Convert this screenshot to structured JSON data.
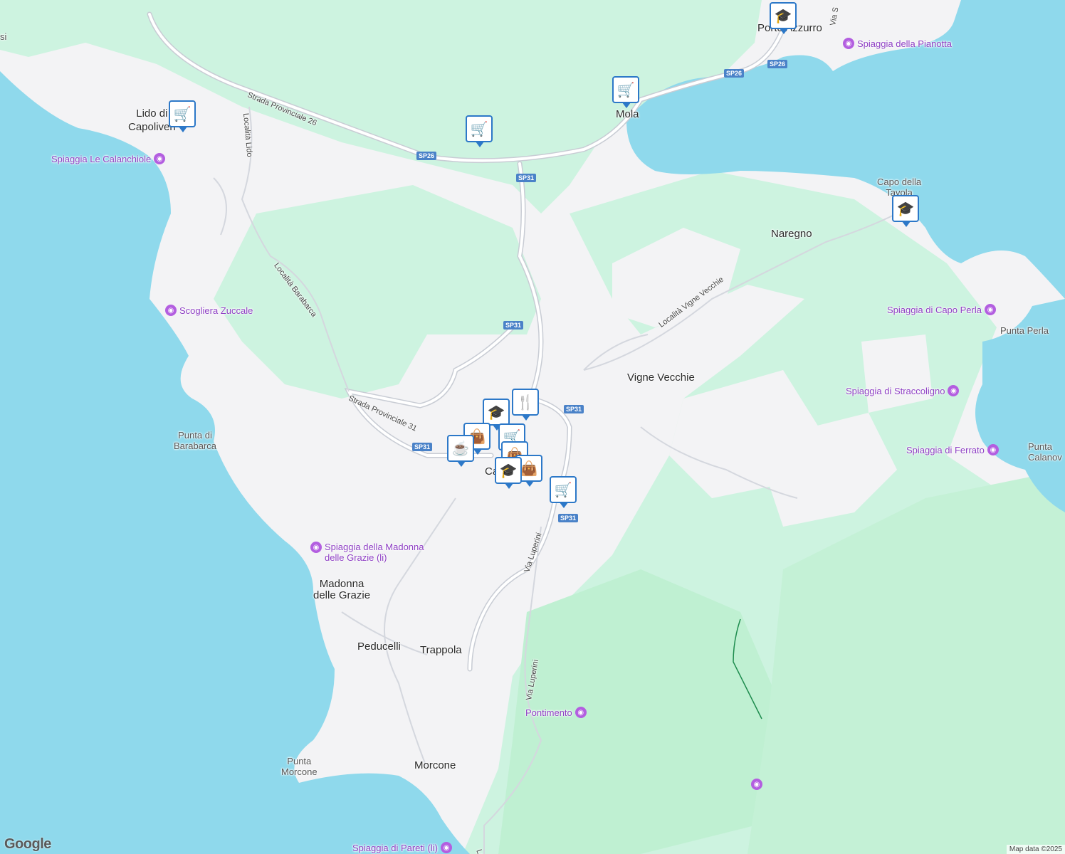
{
  "map": {
    "colors": {
      "water": "#8fd9ec",
      "land": "#f3f3f5",
      "park": "#cdf3e0",
      "park_dark": "#bff0d2",
      "road": "#ffffff",
      "road_outline": "#c8ccd4",
      "poi": "#8e3fc4",
      "marker": "#2c78c8"
    },
    "towns": {
      "lido": "Lido di\nCapoliveri",
      "mola": "Mola",
      "porto_azzurro": "Porto Azzurro",
      "naregno": "Naregno",
      "vigne_vecchie": "Vigne Vecchie",
      "capoliveri": "Ca",
      "madonna": "Madonna\ndelle Grazie",
      "peducelli": "Peducelli",
      "trappola": "Trappola",
      "morcone": "Morcone"
    },
    "places": {
      "capo_tavola": "Capo della\nTavola",
      "punta_perla": "Punta Perla",
      "punta_barabarca": "Punta di\nBarabarca",
      "punta_morcone": "Punta\nMorcone",
      "punta_calanova": "Punta\nCalanov",
      "edge_left": "si"
    },
    "pois": {
      "calanchiole": "Spiaggia Le Calanchiole",
      "zuccale": "Scogliera Zuccale",
      "pianotta": "Spiaggia della Pianotta",
      "capo_perla": "Spiaggia di Capo Perla",
      "straccoligno": "Spiaggia di Straccoligno",
      "ferrato": "Spiaggia di Ferrato",
      "madonna_beach": "Spiaggia della Madonna\ndelle Grazie (li)",
      "pontimento": "Pontimento",
      "pareti": "Spiaggia di Pareti (li)"
    },
    "roads": {
      "sp26_name": "Strada Provinciale 26",
      "sp31_name": "Strada Provinciale 31",
      "lido": "Località Lido",
      "barabarca": "Località Barabarca",
      "vigne": "Località Vigne Vecchie",
      "luperini": "Via Luperini",
      "via_s": "Via S",
      "lo": "Lo"
    },
    "shields": {
      "sp26": "SP26",
      "sp31": "SP31"
    },
    "markers": [
      {
        "icon": "shopping-cart-icon",
        "glyph": "🛒"
      },
      {
        "icon": "graduation-cap-icon",
        "glyph": "🎓"
      },
      {
        "icon": "cutlery-icon",
        "glyph": "🍴"
      },
      {
        "icon": "coffee-cup-icon",
        "glyph": "☕"
      },
      {
        "icon": "shopping-bag-icon",
        "glyph": "👜"
      }
    ],
    "logo": "Google",
    "credit": "Map data ©2025"
  }
}
